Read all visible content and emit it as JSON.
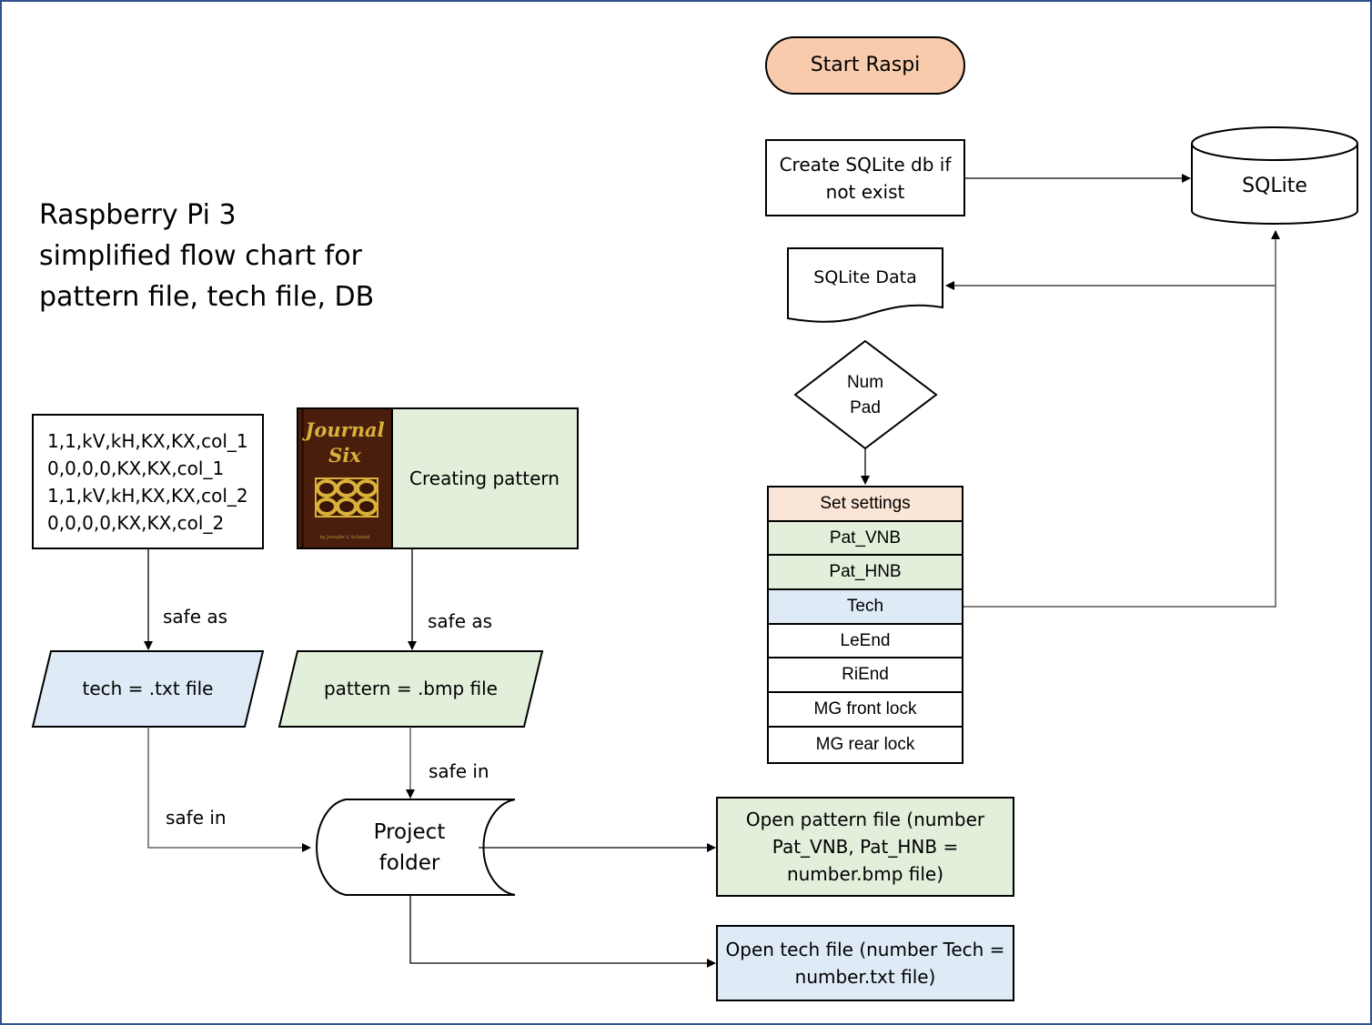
{
  "title": "Raspberry Pi 3\nsimplified flow chart for\npattern file, tech file, DB",
  "nodes": {
    "start": "Start Raspi",
    "create_db": "Create SQLite db if not exist",
    "sqlite": "SQLite",
    "sqlite_data": "SQLite Data",
    "numpad": "Num\nPad",
    "creating_pattern": "Creating pattern",
    "tech_file": "tech = .txt file",
    "pattern_file": "pattern = .bmp file",
    "project_folder": "Project\nfolder",
    "open_pattern": "Open pattern file (number Pat_VNB, Pat_HNB = number.bmp file)",
    "open_tech": "Open tech file (number Tech = number.txt file)"
  },
  "tech_text_lines": [
    "1,1,kV,kH,KX,KX,col_1",
    "0,0,0,0,KX,KX,col_1",
    "1,1,kV,kH,KX,KX,col_2",
    "0,0,0,0,KX,KX,col_2"
  ],
  "book": {
    "title_line1": "Journal",
    "title_line2": "Six",
    "author": "by Jennifer L Schmidt"
  },
  "settings_table": [
    {
      "label": "Set settings",
      "color": "#fbe5d6"
    },
    {
      "label": "Pat_VNB",
      "color": "#e2efda"
    },
    {
      "label": "Pat_HNB",
      "color": "#e2efda"
    },
    {
      "label": "Tech",
      "color": "#deebf7"
    },
    {
      "label": "LeEnd",
      "color": "#ffffff"
    },
    {
      "label": "RiEnd",
      "color": "#ffffff"
    },
    {
      "label": "MG front lock",
      "color": "#ffffff"
    },
    {
      "label": "MG rear lock",
      "color": "#ffffff"
    }
  ],
  "edge_labels": {
    "tech_safe_as": "safe as",
    "pattern_safe_as": "safe as",
    "pattern_safe_in": "safe in",
    "tech_safe_in": "safe in"
  },
  "colors": {
    "start_fill": "#f8cbad",
    "green_fill": "#e2efda",
    "blue_fill": "#deebf7",
    "frame": "#2f528f",
    "book_gold": "#d9b13a"
  }
}
